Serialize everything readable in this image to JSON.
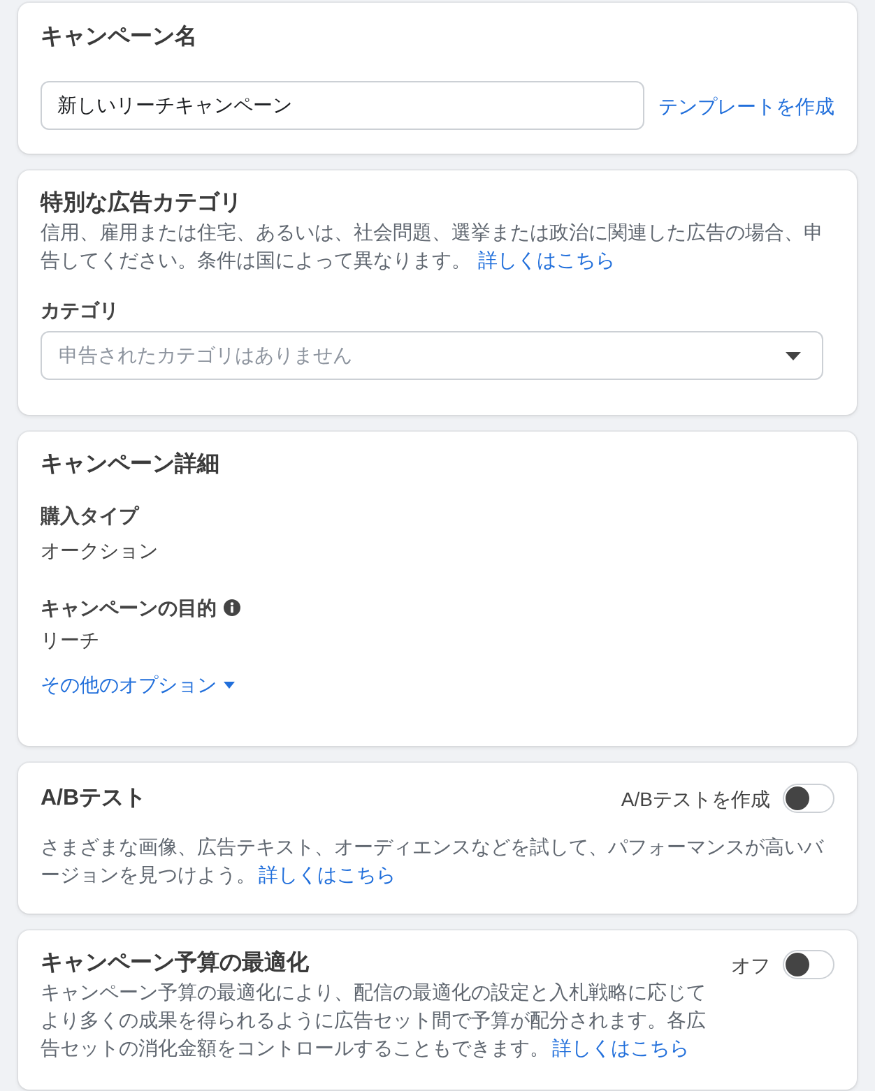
{
  "campaign_name": {
    "title": "キャンペーン名",
    "name_input": {
      "value": "新しいリーチキャンペーン"
    },
    "template_link": "テンプレートを作成"
  },
  "special_ad_category": {
    "title": "特別な広告カテゴリ",
    "description": "信用、雇用または住宅、あるいは、社会問題、選挙または政治に関連した広告の場合、申告してください。条件は国によって異なります。",
    "learn_more_link": "詳しくはこちら",
    "category_label": "カテゴリ",
    "category_dropdown": {
      "placeholder": "申告されたカテゴリはありません"
    }
  },
  "campaign_details": {
    "title": "キャンペーン詳細",
    "fields": [
      {
        "label": "購入タイプ",
        "value": "オークション",
        "info_icon": false
      },
      {
        "label": "キャンペーンの目的",
        "value": "リーチ",
        "info_icon": true
      }
    ],
    "more_options_link": "その他のオプション"
  },
  "ab_test": {
    "title": "A/Bテスト",
    "toggle": {
      "label": "A/Bテストを作成",
      "on": false
    },
    "description": "さまざまな画像、広告テキスト、オーディエンスなどを試して、パフォーマンスが高いバージョンを見つけよう。",
    "learn_more_link": "詳しくはこちら"
  },
  "budget_optimization": {
    "title": "キャンペーン予算の最適化",
    "toggle": {
      "label": "オフ",
      "on": false
    },
    "description": "キャンペーン予算の最適化により、配信の最適化の設定と入札戦略に応じてより多くの成果を得られるように広告セット間で予算が配分されます。各広告セットの消化金額をコントロールすることもできます。",
    "learn_more_link": "詳しくはこちら"
  }
}
